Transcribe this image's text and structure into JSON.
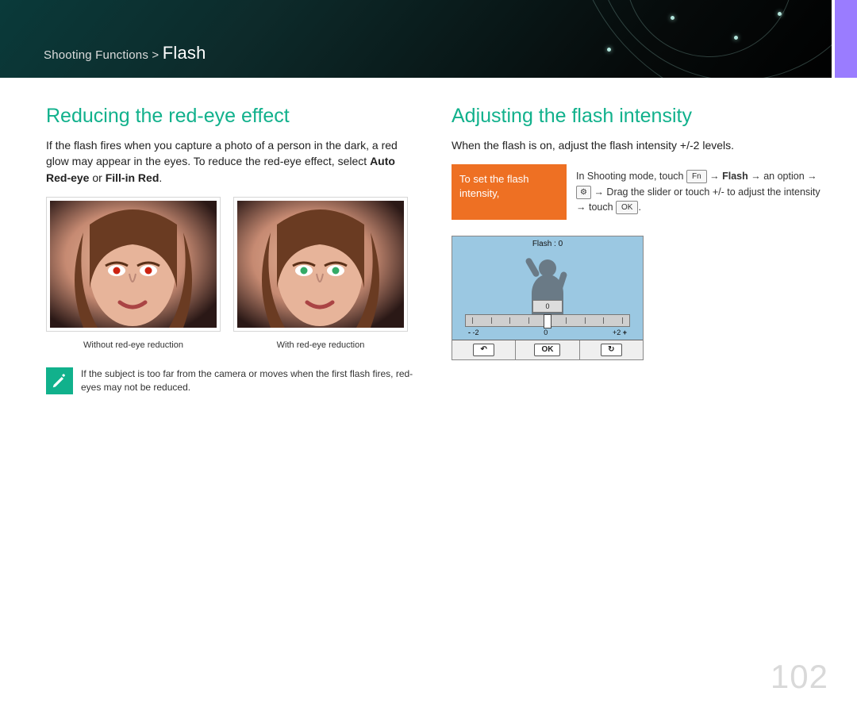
{
  "breadcrumb": {
    "prefix": "Shooting Functions >",
    "current": "Flash"
  },
  "page_number": "102",
  "left": {
    "heading": "Reducing the red-eye effect",
    "body_plain": "If the flash fires when you capture a photo of a person in the dark, a red glow may appear in the eyes. To reduce the red-eye effect, select ",
    "body_bold1": "Auto Red-eye",
    "body_mid": " or ",
    "body_bold2": "Fill-in Red",
    "body_end": ".",
    "caption_without": "Without red-eye reduction",
    "caption_with": "With red-eye reduction",
    "note": "If the subject is too far from the camera or moves when the first flash fires, red-eyes may not be reduced."
  },
  "right": {
    "heading": "Adjusting the flash intensity",
    "body": "When the flash is on, adjust the flash intensity +/-2 levels.",
    "callout_label": "To set the flash intensity,",
    "instr": {
      "pre": "In Shooting mode, touch ",
      "fn": "Fn",
      "arrow": " → ",
      "flash": "Flash",
      "mid1": " → an option → ",
      "sliders_icon": "⚙",
      "mid2": " → Drag the slider or touch +/- to adjust the intensity → touch ",
      "ok": "OK",
      "end": "."
    },
    "screen": {
      "title": "Flash : 0",
      "value": "0",
      "min": "-2",
      "mid": "0",
      "max": "+2",
      "back": "↶",
      "ok": "OK",
      "reset": "↻"
    }
  }
}
